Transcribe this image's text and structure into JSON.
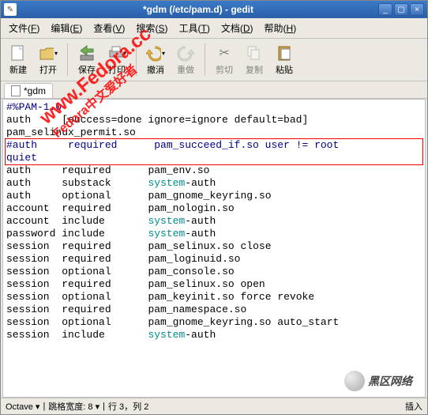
{
  "window": {
    "title": "*gdm (/etc/pam.d) - gedit"
  },
  "menubar": [
    {
      "label": "文件",
      "mnemonic": "F"
    },
    {
      "label": "编辑",
      "mnemonic": "E"
    },
    {
      "label": "查看",
      "mnemonic": "V"
    },
    {
      "label": "搜索",
      "mnemonic": "S"
    },
    {
      "label": "工具",
      "mnemonic": "T"
    },
    {
      "label": "文档",
      "mnemonic": "D"
    },
    {
      "label": "帮助",
      "mnemonic": "H"
    }
  ],
  "toolbar": {
    "new": "新建",
    "open": "打开",
    "save": "保存",
    "print": "打印",
    "undo": "撤消",
    "redo": "重做",
    "cut": "剪切",
    "copy": "复制",
    "paste": "粘贴"
  },
  "tab": {
    "label": "*gdm"
  },
  "editor": {
    "lines": [
      {
        "t": "#%PAM-1.0",
        "cls": "comment"
      },
      {
        "t": "auth     [success=done ignore=ignore default=bad]",
        "cls": "plain"
      },
      {
        "t": "pam_selinux_permit.so",
        "cls": "plain"
      },
      {
        "t": "#auth     required      pam_succeed_if.so user != root",
        "cls": "comment",
        "box_start": true
      },
      {
        "t": "quiet",
        "cls": "comment",
        "box_end": true
      },
      {
        "t": "auth     required      pam_env.so",
        "cls": "mixed"
      },
      {
        "t": "auth     substack      system-auth",
        "cls": "mixed2"
      },
      {
        "t": "auth     optional      pam_gnome_keyring.so",
        "cls": "mixed"
      },
      {
        "t": "account  required      pam_nologin.so",
        "cls": "mixed"
      },
      {
        "t": "account  include       system-auth",
        "cls": "mixed2"
      },
      {
        "t": "password include       system-auth",
        "cls": "mixed2"
      },
      {
        "t": "session  required      pam_selinux.so close",
        "cls": "mixed"
      },
      {
        "t": "session  required      pam_loginuid.so",
        "cls": "mixed"
      },
      {
        "t": "session  optional      pam_console.so",
        "cls": "mixed"
      },
      {
        "t": "session  required      pam_selinux.so open",
        "cls": "mixed"
      },
      {
        "t": "session  optional      pam_keyinit.so force revoke",
        "cls": "mixed"
      },
      {
        "t": "session  required      pam_namespace.so",
        "cls": "mixed"
      },
      {
        "t": "session  optional      pam_gnome_keyring.so auto_start",
        "cls": "mixed"
      },
      {
        "t": "session  include       system-auth",
        "cls": "mixed2"
      }
    ]
  },
  "statusbar": {
    "syntax": "Octave",
    "tabwidth_label": "跳格宽度:",
    "tabwidth_value": "8",
    "line_label": "行",
    "line_value": "3",
    "col_label": "列",
    "col_value": "2",
    "ins": "插入"
  },
  "watermark1": "www.Fedora.cc",
  "watermark1b": "Fedora中文爱好者",
  "watermark2": "黑区网络"
}
